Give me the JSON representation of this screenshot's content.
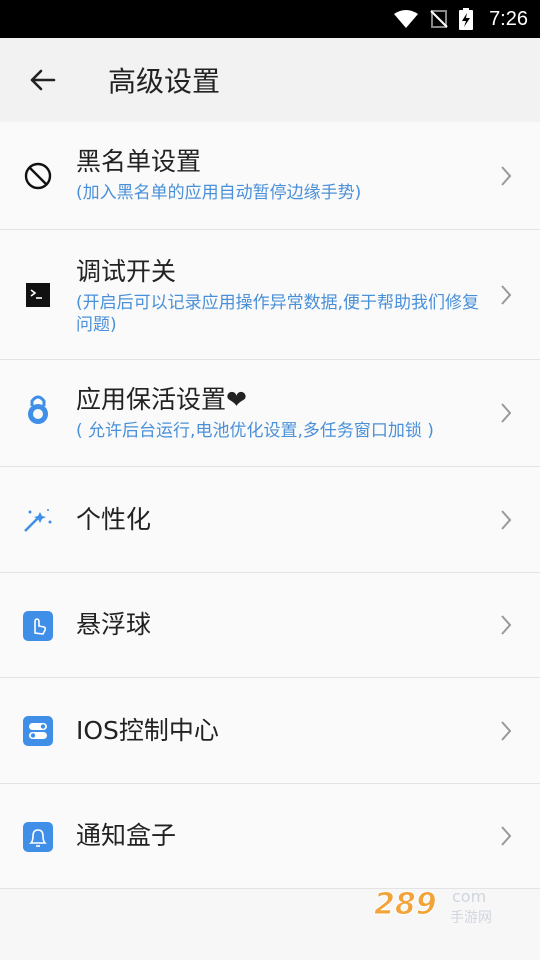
{
  "status": {
    "time": "7:26"
  },
  "header": {
    "title": "高级设置"
  },
  "items": [
    {
      "label": "黑名单设置",
      "sub": "(加入黑名单的应用自动暂停边缘手势)",
      "icon": "block-icon"
    },
    {
      "label": "调试开关",
      "sub": "(开启后可以记录应用操作异常数据,便于帮助我们修复问题)",
      "icon": "terminal-icon"
    },
    {
      "label": "应用保活设置❤",
      "sub": "( 允许后台运行,电池优化设置,多任务窗口加锁 )",
      "icon": "lock-icon"
    },
    {
      "label": "个性化",
      "sub": "",
      "icon": "magic-wand-icon"
    },
    {
      "label": "悬浮球",
      "sub": "",
      "icon": "touch-icon"
    },
    {
      "label": "IOS控制中心",
      "sub": "",
      "icon": "toggle-icon"
    },
    {
      "label": "通知盒子",
      "sub": "",
      "icon": "bell-icon"
    }
  ],
  "watermark": {
    "text": "289.com 手游网"
  },
  "colors": {
    "accent": "#4a90d9",
    "icon_blue": "#3f8ee8",
    "statusbar": "#000000"
  }
}
